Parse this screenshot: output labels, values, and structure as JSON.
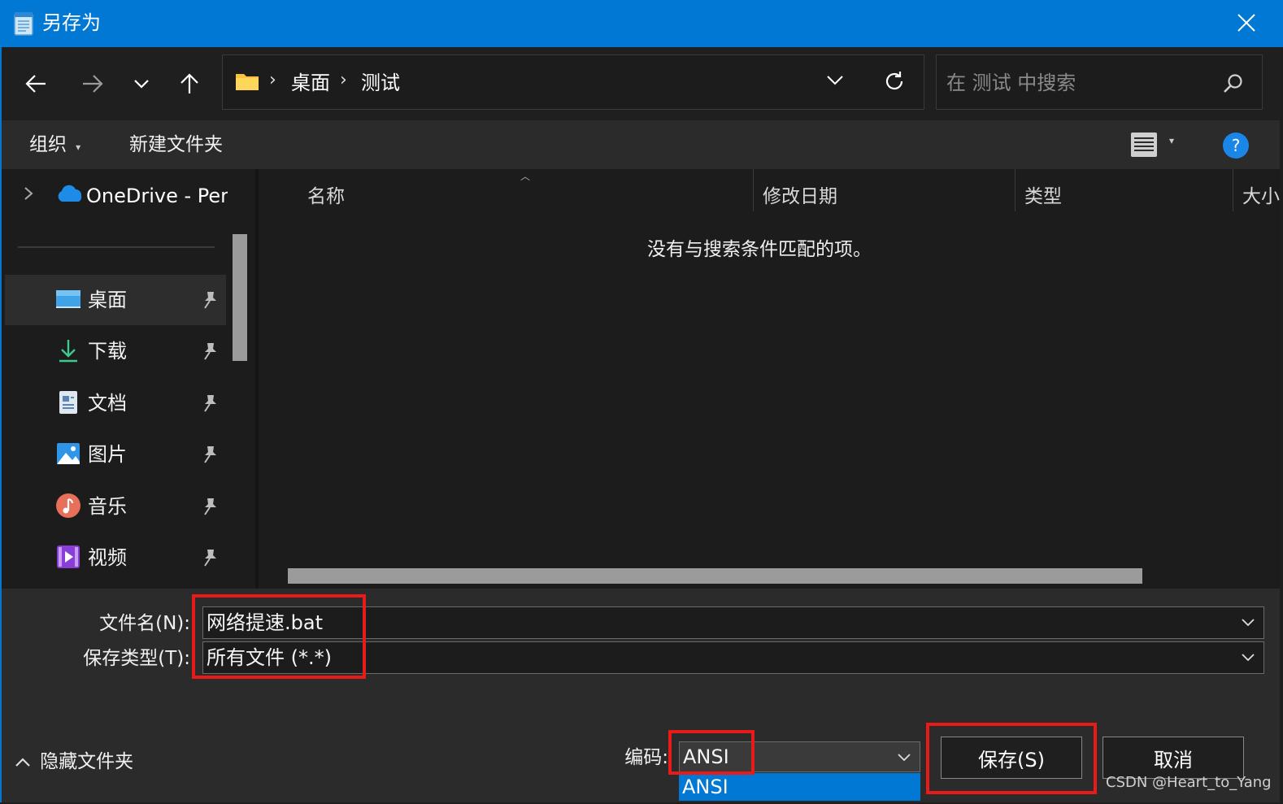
{
  "window": {
    "title": "另存为",
    "accent_color": "#0078d4",
    "title_icon": "notepad-icon",
    "close_icon": "close-icon"
  },
  "nav": {
    "back_icon": "arrow-left-icon",
    "forward_icon": "arrow-right-icon",
    "recent_icon": "chevron-down-icon",
    "up_icon": "arrow-up-icon",
    "breadcrumb": [
      "桌面",
      "测试"
    ],
    "refresh_icon": "refresh-icon",
    "search_placeholder": "在 测试 中搜索",
    "search_icon": "search-icon"
  },
  "toolbar": {
    "organize_label": "组织",
    "new_folder_label": "新建文件夹",
    "view_icon": "list-view-icon",
    "help_icon": "help-icon"
  },
  "sidebar": {
    "onedrive_label": "OneDrive - Per",
    "items": [
      {
        "label": "桌面",
        "icon": "desktop-icon",
        "selected": true
      },
      {
        "label": "下载",
        "icon": "download-icon"
      },
      {
        "label": "文档",
        "icon": "document-icon"
      },
      {
        "label": "图片",
        "icon": "pictures-icon"
      },
      {
        "label": "音乐",
        "icon": "music-icon"
      },
      {
        "label": "视频",
        "icon": "video-icon"
      }
    ]
  },
  "filelist": {
    "columns": [
      "名称",
      "修改日期",
      "类型",
      "大小"
    ],
    "empty_message": "没有与搜索条件匹配的项。"
  },
  "form": {
    "filename_label": "文件名(N):",
    "filename_value": "网络提速.bat",
    "filetype_label": "保存类型(T):",
    "filetype_value": "所有文件  (*.*)",
    "encoding_label": "编码:",
    "encoding_value": "ANSI",
    "encoding_dropdown_option": "ANSI",
    "hide_folders_label": "隐藏文件夹",
    "save_label": "保存(S)",
    "cancel_label": "取消",
    "highlight_color": "#e81a1a"
  },
  "watermark": "CSDN @Heart_to_Yang"
}
